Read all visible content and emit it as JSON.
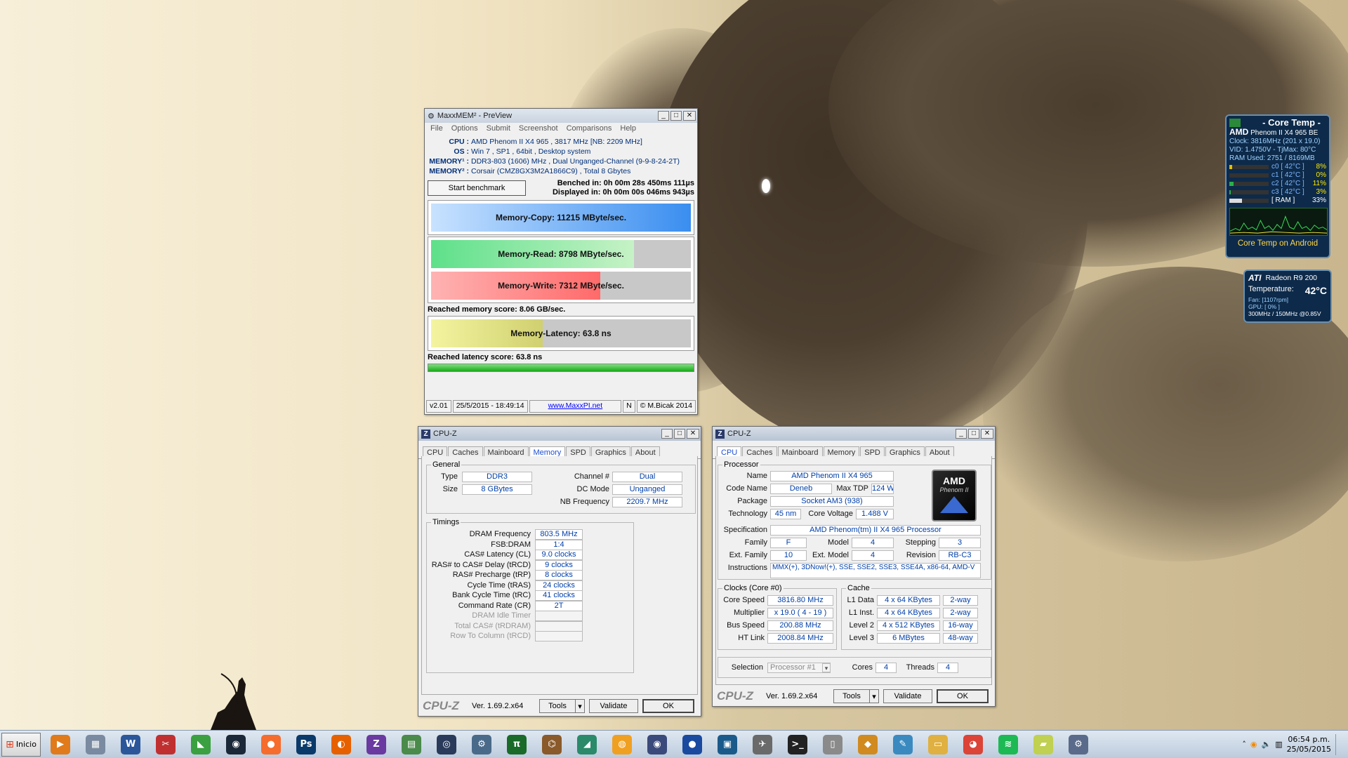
{
  "maxxmem": {
    "title": "MaxxMEM² - PreView",
    "menu": [
      "File",
      "Options",
      "Submit",
      "Screenshot",
      "Comparisons",
      "Help"
    ],
    "cpu_label": "CPU :",
    "cpu": "AMD Phenom II X4 965 , 3817 MHz [NB: 2209 MHz]",
    "os_label": "OS :",
    "os": "Win 7 , SP1 , 64bit , Desktop system",
    "mem1_label": "MEMORY¹ :",
    "mem1": "DDR3-803 (1606) MHz , Dual Unganged-Channel (9-9-8-24-2T)",
    "mem2_label": "MEMORY² :",
    "mem2": "Corsair (CMZ8GX3M2A1866C9) , Total 8 Gbytes",
    "start_button": "Start benchmark",
    "benched": "Benched in: 0h 00m 28s 450ms 111µs",
    "displayed": "Displayed in: 0h 00m 00s 046ms 943µs",
    "copy_label": "Memory-Copy: 11215 MByte/sec.",
    "copy_fill": 1.0,
    "read_label": "Memory-Read: 8798 MByte/sec.",
    "read_fill": 0.78,
    "write_label": "Memory-Write: 7312 MByte/sec.",
    "write_fill": 0.65,
    "mem_score": "Reached memory score: 8.06 GB/sec.",
    "latency_label": "Memory-Latency: 63.8 ns",
    "latency_fill": 0.43,
    "latency_score": "Reached latency score: 63.8 ns",
    "status": [
      "v2.01",
      "25/5/2015 - 18:49:14",
      "www.MaxxPI.net",
      "N",
      "© M.Bicak 2014"
    ]
  },
  "cpuz_tabs": [
    "CPU",
    "Caches",
    "Mainboard",
    "Memory",
    "SPD",
    "Graphics",
    "About"
  ],
  "cpuz_mem": {
    "title": "CPU-Z",
    "general": "General",
    "type_l": "Type",
    "type": "DDR3",
    "size_l": "Size",
    "size": "8 GBytes",
    "chan_l": "Channel #",
    "chan": "Dual",
    "dc_l": "DC Mode",
    "dc": "Unganged",
    "nb_l": "NB Frequency",
    "nb": "2209.7 MHz",
    "timings": "Timings",
    "rows": [
      {
        "l": "DRAM Frequency",
        "v": "803.5 MHz"
      },
      {
        "l": "FSB:DRAM",
        "v": "1:4"
      },
      {
        "l": "CAS# Latency (CL)",
        "v": "9.0 clocks"
      },
      {
        "l": "RAS# to CAS# Delay (tRCD)",
        "v": "9 clocks"
      },
      {
        "l": "RAS# Precharge (tRP)",
        "v": "8 clocks"
      },
      {
        "l": "Cycle Time (tRAS)",
        "v": "24 clocks"
      },
      {
        "l": "Bank Cycle Time (tRC)",
        "v": "41 clocks"
      },
      {
        "l": "Command Rate (CR)",
        "v": "2T"
      },
      {
        "l": "DRAM Idle Timer",
        "v": ""
      },
      {
        "l": "Total CAS# (tRDRAM)",
        "v": ""
      },
      {
        "l": "Row To Column (tRCD)",
        "v": ""
      }
    ],
    "brand": "CPU-Z",
    "ver": "Ver. 1.69.2.x64",
    "tools": "Tools",
    "validate": "Validate",
    "ok": "OK"
  },
  "cpuz_cpu": {
    "title": "CPU-Z",
    "processor": "Processor",
    "name_l": "Name",
    "name": "AMD Phenom II X4 965",
    "code_l": "Code Name",
    "code": "Deneb",
    "tdp_l": "Max TDP",
    "tdp": "124 W",
    "pkg_l": "Package",
    "pkg": "Socket AM3 (938)",
    "tech_l": "Technology",
    "tech": "45 nm",
    "volt_l": "Core Voltage",
    "volt": "1.488 V",
    "spec_l": "Specification",
    "spec": "AMD Phenom(tm) II X4 965 Processor",
    "fam_l": "Family",
    "fam": "F",
    "model_l": "Model",
    "model": "4",
    "step_l": "Stepping",
    "step": "3",
    "efam_l": "Ext. Family",
    "efam": "10",
    "emodel_l": "Ext. Model",
    "emodel": "4",
    "rev_l": "Revision",
    "rev": "RB-C3",
    "instr_l": "Instructions",
    "instr": "MMX(+), 3DNow!(+), SSE, SSE2, SSE3, SSE4A, x86-64, AMD-V",
    "logo_top": "AMD",
    "logo_bot": "Phenom II",
    "clocks": "Clocks (Core #0)",
    "cs_l": "Core Speed",
    "cs": "3816.80 MHz",
    "mul_l": "Multiplier",
    "mul": "x 19.0 ( 4 - 19 )",
    "bus_l": "Bus Speed",
    "bus": "200.88 MHz",
    "ht_l": "HT Link",
    "ht": "2008.84 MHz",
    "cache": "Cache",
    "l1d_l": "L1 Data",
    "l1d": "4 x 64 KBytes",
    "l1d_w": "2-way",
    "l1i_l": "L1 Inst.",
    "l1i": "4 x 64 KBytes",
    "l1i_w": "2-way",
    "l2_l": "Level 2",
    "l2": "4 x 512 KBytes",
    "l2_w": "16-way",
    "l3_l": "Level 3",
    "l3": "6 MBytes",
    "l3_w": "48-way",
    "sel_l": "Selection",
    "sel": "Processor #1",
    "cores_l": "Cores",
    "cores": "4",
    "thr_l": "Threads",
    "thr": "4",
    "brand": "CPU-Z",
    "ver": "Ver. 1.69.2.x64",
    "tools": "Tools",
    "validate": "Validate",
    "ok": "OK"
  },
  "coretemp": {
    "title": "- Core Temp -",
    "brand": "AMD",
    "model": "Phenom II X4 965 BE",
    "clock": "Clock: 3816MHz (201 x 19.0)",
    "vid": "VID: 1.4750V - TjMax: 80°C",
    "ram": "RAM Used: 2751 / 8169MB",
    "cores": [
      {
        "l": "c0 [ 42°C ]",
        "p": "8%",
        "f": 0.08
      },
      {
        "l": "c1 [ 42°C ]",
        "p": "0%",
        "f": 0.0
      },
      {
        "l": "c2 [ 42°C ]",
        "p": "11%",
        "f": 0.11
      },
      {
        "l": "c3 [ 42°C ]",
        "p": "3%",
        "f": 0.03
      }
    ],
    "ram_row": "[ RAM ]",
    "ram_p": "33%",
    "ram_f": 0.33,
    "footer": "Core Temp on Android"
  },
  "gpu": {
    "brand": "ATI",
    "name": "Radeon R9 200",
    "temp_l": "Temperature:",
    "temp": "42°C",
    "fan": "Fan: [1107rpm]",
    "gpu_load": "GPU: [ 0% ]",
    "clocks": "300MHz / 150MHz @0.85V"
  },
  "taskbar": {
    "start": "Inicio",
    "time": "06:54 p.m.",
    "date": "25/05/2015",
    "apps": [
      {
        "name": "media-player-icon",
        "glyph": "▶",
        "color": "#e07a1a"
      },
      {
        "name": "calculator-icon",
        "glyph": "▦",
        "color": "#7a8aa0"
      },
      {
        "name": "word-icon",
        "glyph": "W",
        "color": "#2b579a"
      },
      {
        "name": "snipping-tool-icon",
        "glyph": "✂",
        "color": "#c03030"
      },
      {
        "name": "sheet-icon",
        "glyph": "◣",
        "color": "#3aa040"
      },
      {
        "name": "steam-icon",
        "glyph": "◉",
        "color": "#1b2838"
      },
      {
        "name": "origin-icon",
        "glyph": "●",
        "color": "#f56c2d"
      },
      {
        "name": "photoshop-icon",
        "glyph": "Ps",
        "color": "#0a3a6a"
      },
      {
        "name": "firefox-icon",
        "glyph": "◐",
        "color": "#e66000"
      },
      {
        "name": "cpuz-icon",
        "glyph": "Z",
        "color": "#6a3aa0"
      },
      {
        "name": "maps-icon",
        "glyph": "▤",
        "color": "#4a8a4a"
      },
      {
        "name": "disc-icon",
        "glyph": "◎",
        "color": "#2a3a5a"
      },
      {
        "name": "network-icon",
        "glyph": "⚙",
        "color": "#4a6a8a"
      },
      {
        "name": "superpi-icon",
        "glyph": "π",
        "color": "#1a6a2a"
      },
      {
        "name": "game-icon",
        "glyph": "⌬",
        "color": "#8a5a2a"
      },
      {
        "name": "chart-app-icon",
        "glyph": "◢",
        "color": "#2a8a6a"
      },
      {
        "name": "sound-app-icon",
        "glyph": "◍",
        "color": "#f0a020"
      },
      {
        "name": "eye-app-icon",
        "glyph": "◉",
        "color": "#3a4a7a"
      },
      {
        "name": "globe-icon",
        "glyph": "●",
        "color": "#1a4aa0"
      },
      {
        "name": "coretemp-app-icon",
        "glyph": "▣",
        "color": "#1a5a8a"
      },
      {
        "name": "tools-icon",
        "glyph": "✈",
        "color": "#6a6a6a"
      },
      {
        "name": "terminal-icon",
        "glyph": ">_",
        "color": "#222222"
      },
      {
        "name": "document-icon",
        "glyph": "▯",
        "color": "#8a8a8a"
      },
      {
        "name": "gpu-tool-icon",
        "glyph": "◆",
        "color": "#d08a20"
      },
      {
        "name": "paint-icon",
        "glyph": "✎",
        "color": "#3a8ac0"
      },
      {
        "name": "folder-icon",
        "glyph": "▭",
        "color": "#e0b040"
      },
      {
        "name": "chrome-icon",
        "glyph": "◕",
        "color": "#db4437"
      },
      {
        "name": "spotify-icon",
        "glyph": "≋",
        "color": "#1db954"
      },
      {
        "name": "notes-icon",
        "glyph": "▰",
        "color": "#c0d050"
      },
      {
        "name": "settings-icon",
        "glyph": "⚙",
        "color": "#5a6a8a"
      }
    ]
  }
}
